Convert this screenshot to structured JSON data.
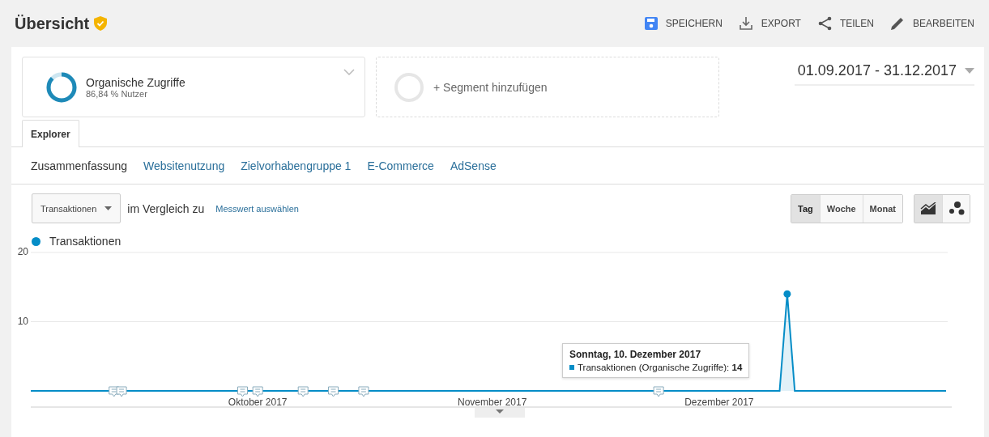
{
  "header": {
    "title": "Übersicht",
    "actions": [
      {
        "kind": "save",
        "label": "SPEICHERN"
      },
      {
        "kind": "export",
        "label": "EXPORT"
      },
      {
        "kind": "share",
        "label": "TEILEN"
      },
      {
        "kind": "edit",
        "label": "BEARBEITEN"
      }
    ]
  },
  "segments": [
    {
      "kind": "active",
      "name": "Organische Zugriffe",
      "detail": "86,84 % Nutzer",
      "level": 0.8684
    },
    {
      "kind": "add",
      "name": "+ Segment hinzufügen"
    }
  ],
  "date_range": "01.09.2017 - 31.12.2017",
  "tabs": [
    {
      "label": "Explorer",
      "selected": true
    }
  ],
  "subnav": [
    {
      "label": "Zusammenfassung",
      "selected": true
    },
    {
      "label": "Websitenutzung",
      "selected": false
    },
    {
      "label": "Zielvorhabengruppe 1",
      "selected": false
    },
    {
      "label": "E-Commerce",
      "selected": false
    },
    {
      "label": "AdSense",
      "selected": false
    }
  ],
  "metric": {
    "value": "Transaktionen",
    "compare_label": "im Vergleich zu",
    "compare_link": "Messwert auswählen"
  },
  "granularity": [
    {
      "label": "Tag",
      "selected": true
    },
    {
      "label": "Woche",
      "selected": false
    },
    {
      "label": "Monat",
      "selected": false
    }
  ],
  "chart_types": [
    {
      "kind": "line",
      "selected": true
    },
    {
      "kind": "motion",
      "selected": false
    }
  ],
  "chart": {
    "tooltip": {
      "title": "Sonntag, 10. Dezember 2017",
      "series": "Transaktionen (Organische Zugriffe): ",
      "value": "14"
    },
    "chart_data": {
      "type": "area",
      "ylim": [
        0,
        20
      ],
      "yticks": [
        10,
        20
      ],
      "categories": [
        null,
        null,
        null,
        null,
        null,
        null,
        null,
        null,
        null,
        null,
        null,
        null,
        null,
        null,
        null,
        null,
        null,
        null,
        null,
        null,
        null,
        null,
        null,
        null,
        null,
        null,
        null,
        null,
        null,
        null,
        "Oktober 2017",
        null,
        null,
        null,
        null,
        null,
        null,
        null,
        null,
        null,
        null,
        null,
        null,
        null,
        null,
        null,
        null,
        null,
        null,
        null,
        null,
        null,
        null,
        null,
        null,
        null,
        null,
        null,
        null,
        null,
        null,
        "November 2017",
        null,
        null,
        null,
        null,
        null,
        null,
        null,
        null,
        null,
        null,
        null,
        null,
        null,
        null,
        null,
        null,
        null,
        null,
        null,
        null,
        null,
        null,
        null,
        null,
        null,
        null,
        null,
        null,
        null,
        "Dezember 2017",
        null,
        null,
        null,
        null,
        null,
        null,
        null,
        null,
        null,
        null,
        null,
        null,
        null,
        null,
        null,
        null,
        null,
        null,
        null,
        null,
        null,
        null,
        null,
        null,
        null,
        null,
        null,
        null,
        null,
        null
      ],
      "series": [
        {
          "name": "Transaktionen",
          "color": "#058dc7",
          "values": [
            0,
            0,
            0,
            0,
            0,
            0,
            0,
            0,
            0,
            0,
            0,
            0,
            0,
            0,
            0,
            0,
            0,
            0,
            0,
            0,
            0,
            0,
            0,
            0,
            0,
            0,
            0,
            0,
            0,
            0,
            0,
            0,
            0,
            0,
            0,
            0,
            0,
            0,
            0,
            0,
            0,
            0,
            0,
            0,
            0,
            0,
            0,
            0,
            0,
            0,
            0,
            0,
            0,
            0,
            0,
            0,
            0,
            0,
            0,
            0,
            0,
            0,
            0,
            0,
            0,
            0,
            0,
            0,
            0,
            0,
            0,
            0,
            0,
            0,
            0,
            0,
            0,
            0,
            0,
            0,
            0,
            0,
            0,
            0,
            0,
            0,
            0,
            0,
            0,
            0,
            0,
            0,
            0,
            0,
            0,
            0,
            0,
            0,
            0,
            0,
            14,
            0,
            0,
            0,
            0,
            0,
            0,
            0,
            0,
            0,
            0,
            0,
            0,
            0,
            0,
            0,
            0,
            0,
            0,
            0,
            0,
            0
          ]
        }
      ]
    }
  }
}
